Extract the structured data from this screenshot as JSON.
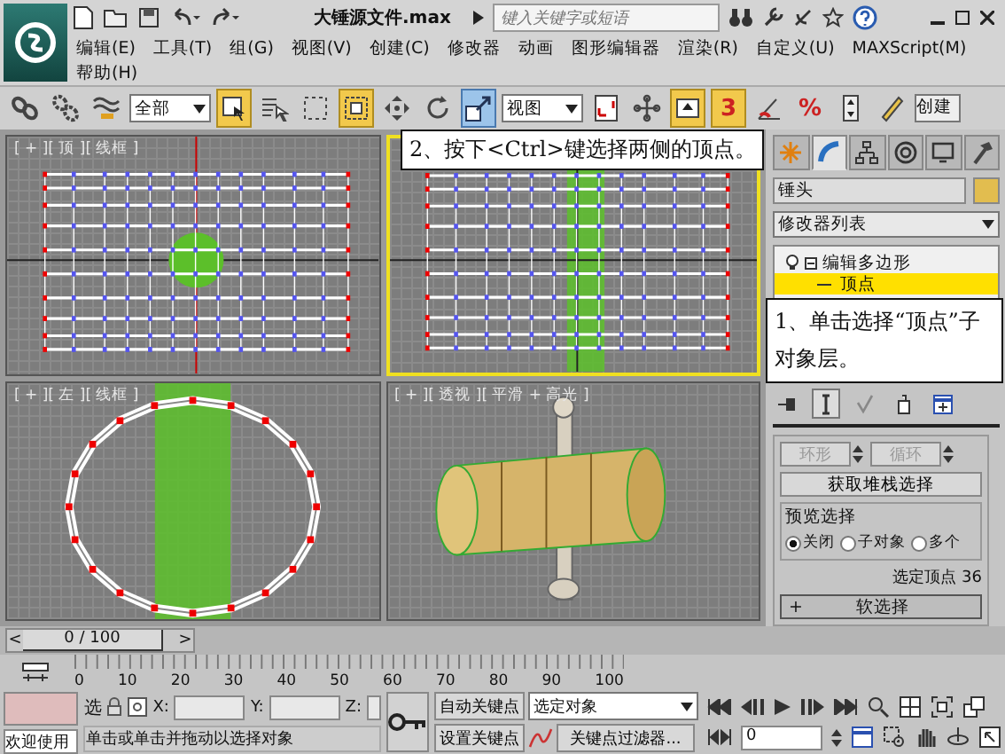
{
  "title_bar": {
    "title": "大锤源文件.max",
    "search": {
      "placeholder": "键入关键字或短语"
    }
  },
  "menu_rows": [
    [
      "编辑(E)",
      "工具(T)",
      "组(G)",
      "视图(V)",
      "创建(C)",
      "修改器",
      "动画",
      "图形编辑器",
      "渲染(R)",
      "自定义(U)",
      "MAXScript(M)"
    ],
    [
      "帮助(H)"
    ]
  ],
  "toolbar": [
    {
      "kind": "link",
      "active": false
    },
    {
      "kind": "unlink",
      "active": false
    },
    {
      "kind": "bind",
      "active": false
    },
    {
      "kind": "dropdown",
      "value": "全部"
    },
    {
      "kind": "select",
      "active": true
    },
    {
      "kind": "list",
      "active": false
    },
    {
      "kind": "region",
      "active": false
    },
    {
      "kind": "window",
      "active": true
    },
    {
      "kind": "move",
      "active": false
    },
    {
      "kind": "rotate",
      "active": false
    },
    {
      "kind": "scale",
      "active": true
    },
    {
      "kind": "dropdown",
      "value": "视图"
    },
    {
      "kind": "pivot",
      "active": false
    },
    {
      "kind": "manipulate",
      "active": false
    },
    {
      "kind": "keyboard",
      "active": true
    },
    {
      "kind": "snap",
      "label": "3",
      "active": true
    },
    {
      "kind": "angle",
      "active": false
    },
    {
      "kind": "snap",
      "label": "%",
      "active": false
    },
    {
      "kind": "spinner",
      "active": false
    },
    {
      "kind": "pencil",
      "active": false
    },
    {
      "kind": "field",
      "value": "创建"
    }
  ],
  "viewports": [
    {
      "kind": "top",
      "label": "[ + ][ 顶 ][ 线框 ]",
      "selected": false
    },
    {
      "kind": "front",
      "selected": true
    },
    {
      "kind": "left",
      "label": "[ + ][ 左 ][ 线框 ]",
      "selected": false
    },
    {
      "kind": "perspective",
      "label": "[ + ][ 透视 ][ 平滑 + 高光 ]",
      "selected": false
    }
  ],
  "callouts": [
    {
      "text": "2、按下<Ctrl>键选择两侧的顶点。"
    },
    {
      "text": "1、单击选择“顶点”子对象层。"
    }
  ],
  "command_panel": {
    "tabs": [
      {
        "kind": "create",
        "selected": false
      },
      {
        "kind": "modify",
        "selected": true
      },
      {
        "kind": "hierarchy",
        "selected": false
      },
      {
        "kind": "motion",
        "selected": false
      },
      {
        "kind": "display",
        "selected": false
      },
      {
        "kind": "utilities",
        "selected": false
      }
    ],
    "object_name": "锤头",
    "modifier_list": "修改器列表",
    "stack": [
      {
        "label": "编辑多边形",
        "expanded": true,
        "selected": false,
        "children": [
          {
            "label": "顶点",
            "selected": true
          }
        ]
      }
    ],
    "stack_buttons": [
      {
        "kind": "pin",
        "active": false
      },
      {
        "kind": "result",
        "active": true
      },
      {
        "kind": "unique",
        "active": false
      },
      {
        "kind": "remove",
        "active": false
      },
      {
        "kind": "configure",
        "active": false
      }
    ],
    "ring_loop": [
      {
        "label": "环形",
        "disabled": true
      },
      {
        "label": "循环",
        "disabled": true
      }
    ],
    "get_stack_selection": "获取堆栈选择",
    "preview": {
      "title": "预览选择",
      "options": [
        {
          "label": "关闭",
          "selected": true
        },
        {
          "label": "子对象",
          "selected": false
        },
        {
          "label": "多个",
          "selected": false
        }
      ]
    },
    "selection_info": "选定顶点 36",
    "soft_selection": {
      "sign": "+",
      "title": "软选择"
    }
  },
  "timeline": {
    "prev": "<",
    "label": "0 / 100",
    "next": ">",
    "ticks": [
      "0",
      "10",
      "20",
      "30",
      "40",
      "50",
      "60",
      "70",
      "80",
      "90",
      "100"
    ]
  },
  "status": {
    "welcome": "欢迎使用",
    "lock": "选",
    "x": "X:",
    "y": "Y:",
    "z": "Z:",
    "prompt": "单击或单击并拖动以选择对象",
    "auto_key": "自动关键点",
    "set_key": "设置关键点",
    "key_mode": "选定对象",
    "key_filters": "关键点过滤器...",
    "frame": "0"
  }
}
